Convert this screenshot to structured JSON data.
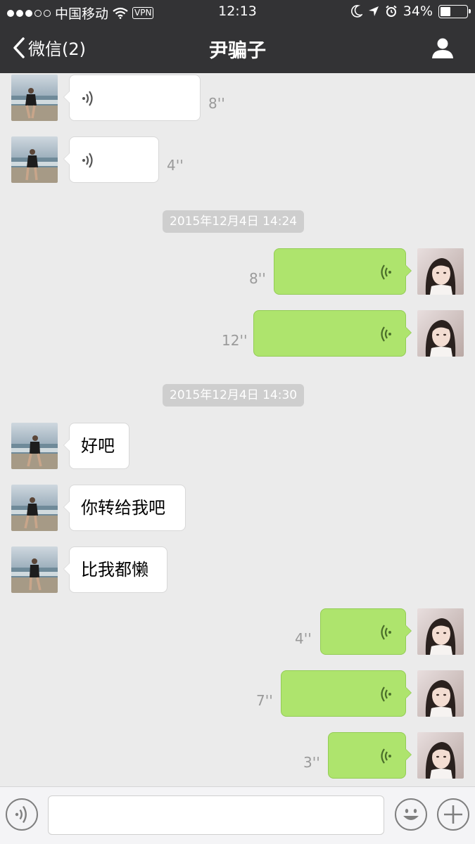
{
  "status_bar": {
    "carrier": "中国移动",
    "vpn": "VPN",
    "time": "12:13",
    "battery_text": "34%",
    "battery_level": 0.34,
    "signal_strength": 3
  },
  "nav": {
    "back_label": "微信(2)",
    "title": "尹骗子",
    "profile_icon": "person-icon"
  },
  "messages": [
    {
      "side": "in",
      "type": "voice",
      "duration": "8''"
    },
    {
      "side": "in",
      "type": "voice",
      "duration": "4''"
    },
    {
      "type": "timestamp",
      "text": "2015年12月4日 14:24"
    },
    {
      "side": "out",
      "type": "voice",
      "duration": "8''"
    },
    {
      "side": "out",
      "type": "voice",
      "duration": "12''"
    },
    {
      "type": "timestamp",
      "text": "2015年12月4日 14:30"
    },
    {
      "side": "in",
      "type": "text",
      "text": "好吧"
    },
    {
      "side": "in",
      "type": "text",
      "text": "你转给我吧"
    },
    {
      "side": "in",
      "type": "text",
      "text": "比我都懒"
    },
    {
      "side": "out",
      "type": "voice",
      "duration": "4''"
    },
    {
      "side": "out",
      "type": "voice",
      "duration": "7''"
    },
    {
      "side": "out",
      "type": "voice",
      "duration": "3''"
    }
  ],
  "input_bar": {
    "voice_icon": "voice-icon",
    "emoji_icon": "smiley-icon",
    "plus_icon": "plus-icon",
    "placeholder": ""
  },
  "colors": {
    "bar_bg": "#333335",
    "chat_bg": "#ebebeb",
    "outgoing_bubble": "#aee46d",
    "incoming_bubble": "#ffffff",
    "timestamp_bg": "#cecece"
  }
}
